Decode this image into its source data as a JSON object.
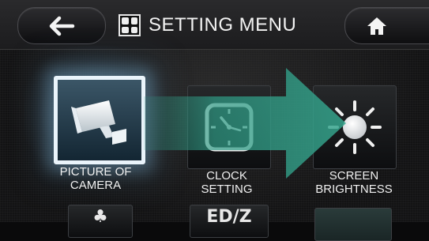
{
  "header": {
    "title": "SETTING MENU",
    "back_icon": "arrow-left-icon",
    "home_icon": "home-icon",
    "menu_icon": "grid-menu-icon"
  },
  "menu": {
    "items": [
      {
        "label_line1": "PICTURE OF",
        "label_line2": "CAMERA",
        "icon": "camera-icon",
        "selected": true
      },
      {
        "label_line1": "CLOCK",
        "label_line2": "SETTING",
        "icon": "clock-icon",
        "selected": false
      },
      {
        "label_line1": "SCREEN",
        "label_line2": "BRIGHTNESS",
        "icon": "sun-icon",
        "selected": false
      }
    ],
    "bottom_row_partial": [
      {
        "glyph": "♣",
        "icon": "partial-icon-1"
      },
      {
        "glyph": "ED/Z",
        "icon": "partial-icon-2"
      },
      {
        "glyph": "",
        "icon": "partial-icon-3"
      }
    ]
  },
  "colors": {
    "accent_arrow": "#2f9c86",
    "selected_border": "#eaf4fb",
    "background": "#131314"
  }
}
